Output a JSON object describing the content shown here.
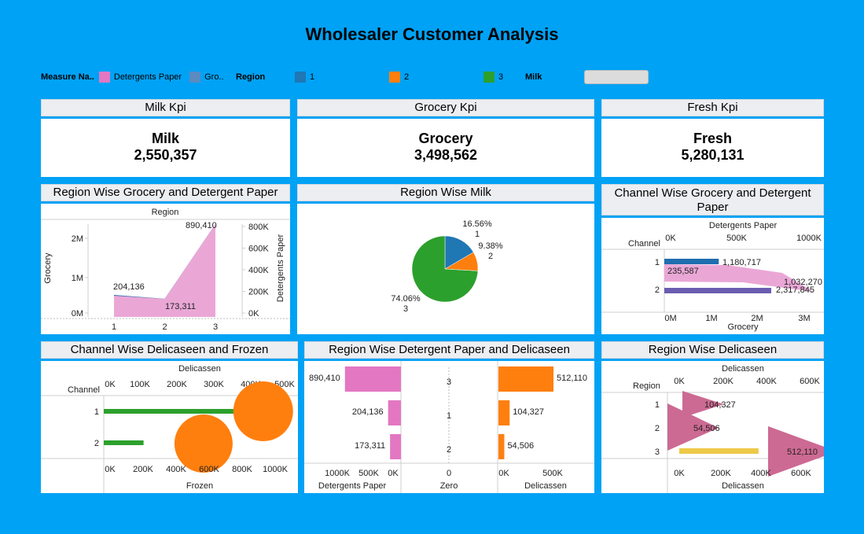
{
  "title": "Wholesaler Customer Analysis",
  "legend": {
    "measure_label": "Measure Na..",
    "measure_items": [
      {
        "label": "Detergents Paper",
        "color": "#e377c2"
      },
      {
        "label": "Gro..",
        "color": "#5b8ac0"
      }
    ],
    "region_label": "Region",
    "region_items": [
      {
        "label": "1",
        "color": "#1f77b4"
      },
      {
        "label": "2",
        "color": "#ff7f0e"
      },
      {
        "label": "3",
        "color": "#2ca02c"
      }
    ],
    "milk_label": "Milk"
  },
  "kpis": [
    {
      "title": "Milk Kpi",
      "name": "Milk",
      "value": "2,550,357"
    },
    {
      "title": "Grocery Kpi",
      "name": "Grocery",
      "value": "3,498,562"
    },
    {
      "title": "Fresh Kpi",
      "name": "Fresh",
      "value": "5,280,131"
    }
  ],
  "colors": {
    "region1": "#1f77b4",
    "region2": "#ff7f0e",
    "region3": "#2ca02c",
    "detergents": "#e377c2",
    "yellow": "#edc948",
    "triangle": "#cc6a93"
  },
  "chart_data": [
    {
      "id": "region-grocery-detergent",
      "title": "Region Wise Grocery and Detergent Paper",
      "type": "area",
      "header": "Region",
      "x": [
        "1",
        "2",
        "3"
      ],
      "series": [
        {
          "name": "Grocery",
          "axis": "left",
          "values": [
            570000,
            470000,
            2400000
          ]
        },
        {
          "name": "Detergents Paper",
          "axis": "right",
          "values": [
            204136,
            173311,
            890410
          ]
        }
      ],
      "point_labels": [
        "204,136",
        "173,311",
        "890,410"
      ],
      "ylabel_left": "Grocery",
      "ylabel_right": "Detergents Paper",
      "ylim_left": [
        0,
        2400000
      ],
      "ylim_right": [
        0,
        890410
      ],
      "left_ticks": [
        "0M",
        "1M",
        "2M"
      ],
      "right_ticks": [
        "0K",
        "200K",
        "400K",
        "600K",
        "800K"
      ],
      "x_ticks": [
        "1",
        "2",
        "3"
      ]
    },
    {
      "id": "region-milk",
      "title": "Region Wise Milk",
      "type": "pie",
      "slices": [
        {
          "region": "1",
          "percent": 16.56,
          "label": "16.56%"
        },
        {
          "region": "2",
          "percent": 9.38,
          "label": "9.38%"
        },
        {
          "region": "3",
          "percent": 74.06,
          "label": "74.06%"
        }
      ]
    },
    {
      "id": "channel-grocery-detergent",
      "title": "Channel Wise Grocery and Detergent Paper",
      "type": "bar",
      "top_axis_title": "Detergents Paper",
      "bottom_axis_title": "Grocery",
      "row_header": "Channel",
      "categories": [
        "1",
        "2"
      ],
      "grocery": [
        1180717,
        2317845
      ],
      "detergents": [
        235587,
        1032270
      ],
      "labels": {
        "grocery": [
          "1,180,717",
          "2,317,845"
        ],
        "detergents": [
          "235,587",
          "1,032,270"
        ]
      },
      "top_ticks": [
        "0K",
        "500K",
        "1000K"
      ],
      "bottom_ticks": [
        "0M",
        "1M",
        "2M",
        "3M"
      ]
    },
    {
      "id": "channel-delicassen-frozen",
      "title": "Channel Wise Delicaseen and Frozen",
      "type": "scatter",
      "top_axis_title": "Delicassen",
      "bottom_axis_title": "Frozen",
      "row_header": "Channel",
      "categories": [
        "1",
        "2"
      ],
      "delicassen": [
        420000,
        110000
      ],
      "frozen": [
        950000,
        580000
      ],
      "top_ticks": [
        "0K",
        "100K",
        "200K",
        "300K",
        "400K",
        "500K"
      ],
      "bottom_ticks": [
        "0K",
        "200K",
        "400K",
        "600K",
        "800K",
        "1000K"
      ]
    },
    {
      "id": "region-detergent-delicaseen",
      "title": "Region Wise Detergent Paper and Delicaseen",
      "type": "bar",
      "categories": [
        "3",
        "1",
        "2"
      ],
      "detergents": [
        890410,
        204136,
        173311
      ],
      "delicassen": [
        512110,
        104327,
        54506
      ],
      "labels": {
        "detergents": [
          "890,410",
          "204,136",
          "173,311"
        ],
        "delicassen": [
          "512,110",
          "104,327",
          "54,506"
        ]
      },
      "left_axis_title": "Detergents Paper",
      "center_axis_title": "Zero",
      "right_axis_title": "Delicassen",
      "left_ticks": [
        "1000K",
        "500K",
        "0K"
      ],
      "center_ticks": [
        "0"
      ],
      "right_ticks": [
        "0K",
        "500K"
      ]
    },
    {
      "id": "region-delicaseen",
      "title": "Region Wise Delicaseen",
      "type": "bar",
      "top_axis_title": "Delicassen",
      "bottom_axis_title": "Delicassen",
      "row_header": "Region",
      "categories": [
        "1",
        "2",
        "3"
      ],
      "values": [
        104327,
        54506,
        512110
      ],
      "labels": [
        "104,327",
        "54,506",
        "512,110"
      ],
      "top_ticks": [
        "0K",
        "200K",
        "400K",
        "600K"
      ],
      "bottom_ticks": [
        "0K",
        "200K",
        "400K",
        "600K"
      ]
    }
  ]
}
